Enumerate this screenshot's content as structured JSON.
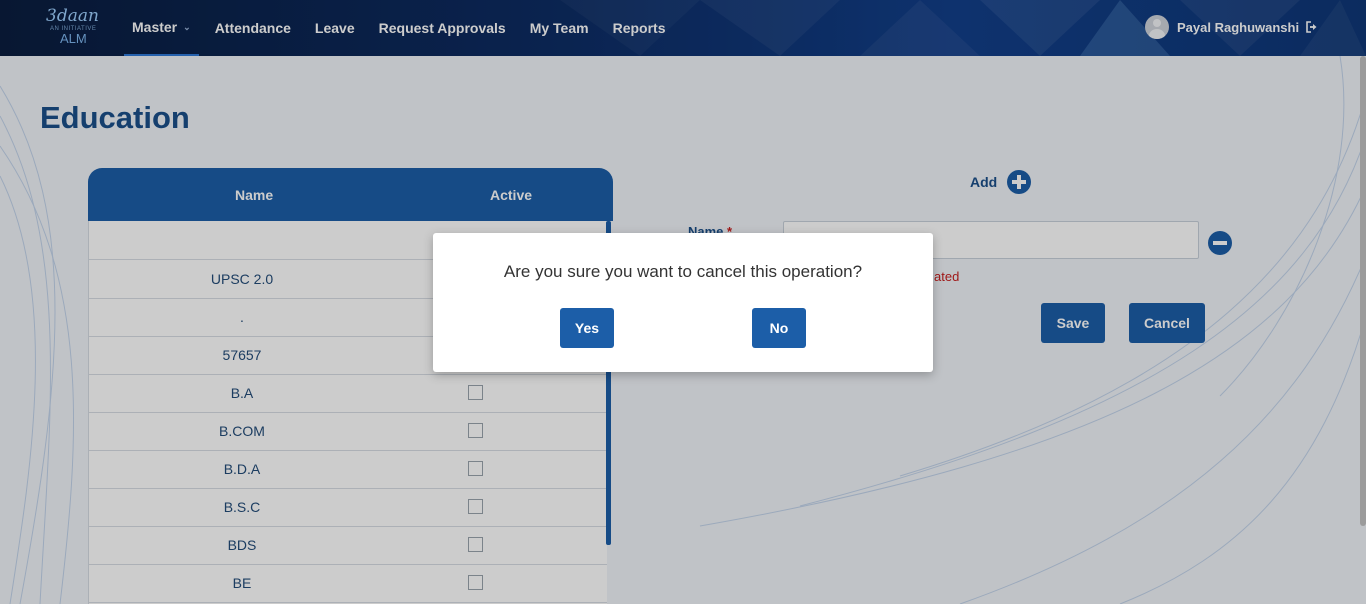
{
  "brand": {
    "script": "3daan",
    "sub": "AN INITIATIVE",
    "product": "ALM"
  },
  "nav": {
    "items": [
      {
        "label": "Master",
        "active": true,
        "has_dropdown": true
      },
      {
        "label": "Attendance"
      },
      {
        "label": "Leave"
      },
      {
        "label": "Request Approvals"
      },
      {
        "label": "My Team"
      },
      {
        "label": "Reports"
      }
    ]
  },
  "user": {
    "name": "Payal Raghuwanshi",
    "avatar_icon": "user-avatar-icon",
    "logout_icon": "logout-icon"
  },
  "page": {
    "title": "Education"
  },
  "grid": {
    "columns": [
      "Name",
      "Active"
    ],
    "rows": [
      {
        "name": "",
        "active": null
      },
      {
        "name": "UPSC 2.0",
        "active": false
      },
      {
        "name": ".",
        "active": false
      },
      {
        "name": "57657",
        "active": false
      },
      {
        "name": "B.A",
        "active": false
      },
      {
        "name": "B.COM",
        "active": false
      },
      {
        "name": "B.D.A",
        "active": false
      },
      {
        "name": "B.S.C",
        "active": false
      },
      {
        "name": "BDS",
        "active": false
      },
      {
        "name": "BE",
        "active": false
      }
    ]
  },
  "form": {
    "add_label": "Add",
    "name_label": "Name",
    "required_mark": "*",
    "name_value": "",
    "error_text": "ated",
    "save_label": "Save",
    "cancel_label": "Cancel"
  },
  "modal": {
    "message": "Are you sure you want to cancel this operation?",
    "yes_label": "Yes",
    "no_label": "No"
  },
  "colors": {
    "primary": "#1c5ea8",
    "title": "#1b4f8a",
    "error": "#c81f1f",
    "nav_bg": "#0d2c63"
  }
}
